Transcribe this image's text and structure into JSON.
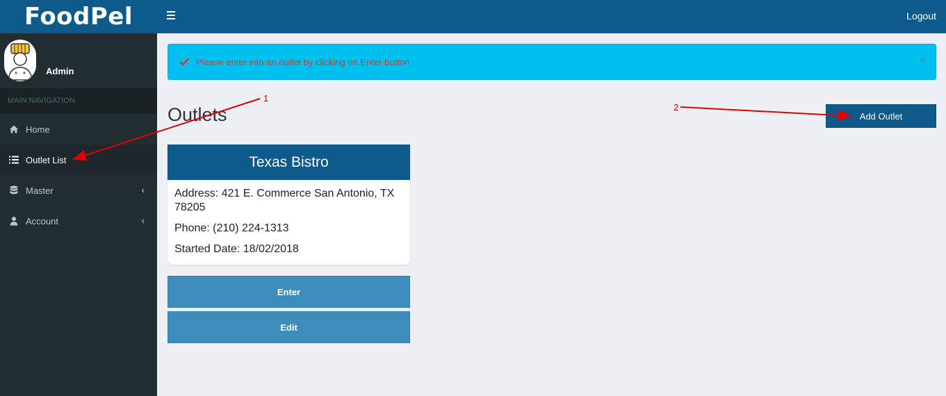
{
  "header": {
    "logo": "FoodPel",
    "logout_label": "Logout"
  },
  "sidebar": {
    "user_name": "Admin",
    "nav_header": "MAIN NAVIGATION",
    "items": [
      {
        "label": "Home",
        "icon": "home-icon"
      },
      {
        "label": "Outlet List",
        "icon": "list-icon",
        "active": true
      },
      {
        "label": "Master",
        "icon": "database-icon"
      },
      {
        "label": "Account",
        "icon": "user-icon"
      }
    ]
  },
  "alert": {
    "message": "Please enter into an outlet by clicking on Enter button",
    "close": "×"
  },
  "main": {
    "title": "Outlets",
    "add_button": "Add Outlet",
    "outlet": {
      "name": "Texas Bistro",
      "address": "Address: 421 E. Commerce San Antonio, TX 78205",
      "phone": "Phone: (210) 224-1313",
      "started": "Started Date: 18/02/2018"
    },
    "enter_button": "Enter",
    "edit_button": "Edit"
  },
  "annotations": {
    "one": "1",
    "two": "2"
  },
  "colors": {
    "brand": "#0e5a8a",
    "sidebar": "#222d32",
    "alert": "#00c0ef",
    "button": "#3c8dbc",
    "annotation": "#e00000"
  }
}
